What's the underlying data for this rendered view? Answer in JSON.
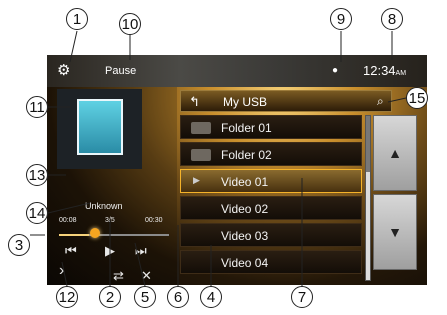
{
  "callouts": [
    "1",
    "2",
    "3",
    "4",
    "5",
    "6",
    "7",
    "8",
    "9",
    "10",
    "11",
    "12",
    "13",
    "14",
    "15"
  ],
  "topbar": {
    "status": "Pause",
    "time": "12:34",
    "ampm": "AM"
  },
  "player": {
    "song_title": "Unknown",
    "time_elapsed": "00:08",
    "track_position": "3/5",
    "time_total": "00:30",
    "progress": 0.27
  },
  "list": {
    "header_title": "My USB",
    "rows": [
      {
        "label": "Folder 01",
        "type": "folder"
      },
      {
        "label": "Folder 02",
        "type": "folder"
      },
      {
        "label": "Video 01",
        "type": "video",
        "selected": true
      },
      {
        "label": "Video 02",
        "type": "video"
      },
      {
        "label": "Video 03",
        "type": "video"
      },
      {
        "label": "Video 04",
        "type": "video"
      }
    ]
  }
}
